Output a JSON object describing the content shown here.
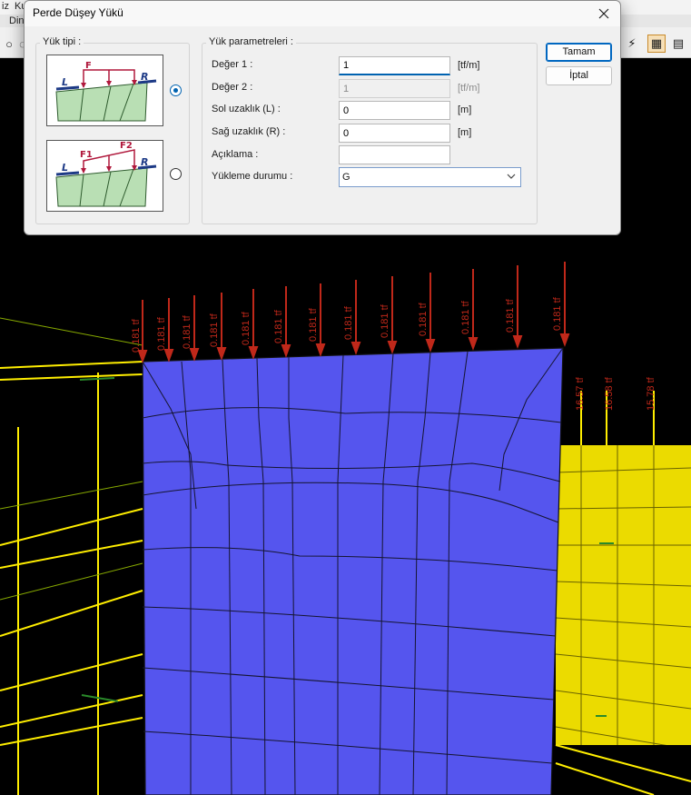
{
  "menubar": {
    "item1": "iz",
    "item2": "Ku",
    "item3": "Din"
  },
  "dialog": {
    "title": "Perde Düşey Yükü",
    "load_type_group": {
      "legend": "Yük tipi :",
      "uniform_diagram": {
        "left_label": "L",
        "load_label": "F",
        "right_label": "R"
      },
      "trapezoid_diagram": {
        "left_label": "L",
        "load1_label": "F1",
        "load2_label": "F2",
        "right_label": "R"
      },
      "selected": "uniform"
    },
    "params_group": {
      "legend": "Yük parametreleri :",
      "value1": {
        "label": "Değer 1 :",
        "value": "1",
        "unit": "[tf/m]"
      },
      "value2": {
        "label": "Değer 2 :",
        "value": "1",
        "unit": "[tf/m]"
      },
      "left_distance": {
        "label": "Sol uzaklık (L) :",
        "value": "0",
        "unit": "[m]"
      },
      "right_distance": {
        "label": "Sağ uzaklık (R) :",
        "value": "0",
        "unit": "[m]"
      },
      "description": {
        "label": "Açıklama :",
        "value": ""
      },
      "load_case": {
        "label": "Yükleme durumu :",
        "value": "G"
      }
    },
    "ok_label": "Tamam",
    "cancel_label": "İptal"
  },
  "viewport": {
    "load_arrow_label": "0.181 tf",
    "side_labels": [
      "16.57 tf",
      "16.58 tf",
      "15.78 tf"
    ]
  },
  "colors": {
    "wall": "#5555ee",
    "frame": "#ffee00",
    "load_arrow": "#c0281a",
    "accent": "#0063b1"
  }
}
